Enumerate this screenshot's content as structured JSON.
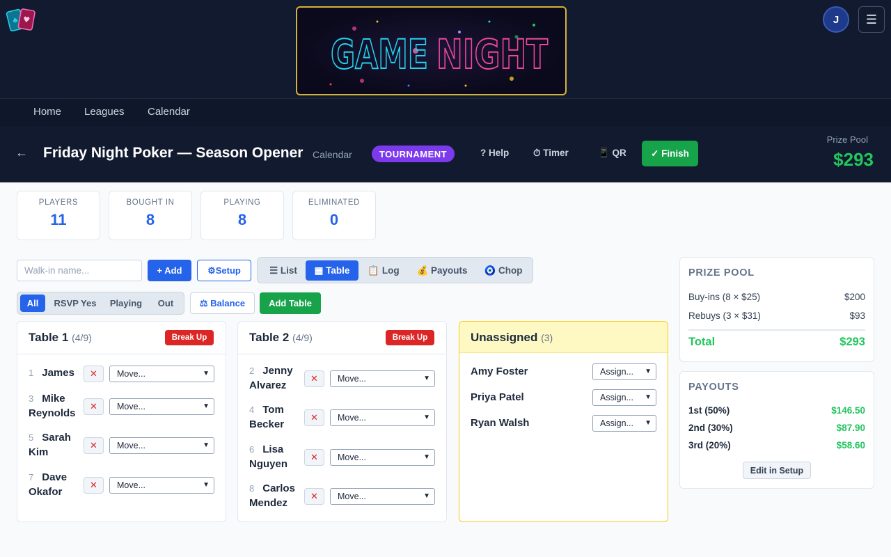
{
  "header": {
    "banner_word1": "GAME",
    "banner_word2": "NIGHT",
    "avatar_initial": "J",
    "menu_icon": "☰"
  },
  "nav": {
    "items": [
      "Home",
      "Leagues",
      "Calendar"
    ]
  },
  "event": {
    "back": "←",
    "title": "Friday Night Poker — Season Opener",
    "subtitle": "Calendar",
    "badge": "TOURNAMENT",
    "help": "? Help",
    "timer": "⏱ Timer",
    "qr": "📱 QR",
    "finish": "✓ Finish",
    "prize_pool_label": "Prize Pool",
    "prize_pool_value": "$293"
  },
  "stats": [
    {
      "label": "PLAYERS",
      "value": "11"
    },
    {
      "label": "BOUGHT IN",
      "value": "8"
    },
    {
      "label": "PLAYING",
      "value": "8"
    },
    {
      "label": "ELIMINATED",
      "value": "0"
    }
  ],
  "controls": {
    "walkin_placeholder": "Walk-in name...",
    "add": "+ Add",
    "setup": "⚙Setup",
    "view_tabs": [
      "☰ List",
      "▦ Table",
      "📋 Log",
      "💰 Payouts",
      "🧿 Chop"
    ],
    "active_view": "▦ Table",
    "filters": [
      "All",
      "RSVP Yes",
      "Playing",
      "Out"
    ],
    "active_filter": "All",
    "balance": "⚖ Balance",
    "add_table": "Add Table"
  },
  "tables": [
    {
      "name": "Table 1",
      "count": "(4/9)",
      "break_up": "Break Up",
      "players": [
        {
          "seat": "1",
          "first": "James",
          "last": "",
          "move": "Move..."
        },
        {
          "seat": "3",
          "first": "Mike",
          "last": "Reynolds",
          "move": "Move..."
        },
        {
          "seat": "5",
          "first": "Sarah",
          "last": "Kim",
          "move": "Move..."
        },
        {
          "seat": "7",
          "first": "Dave",
          "last": "Okafor",
          "move": "Move..."
        }
      ]
    },
    {
      "name": "Table 2",
      "count": "(4/9)",
      "break_up": "Break Up",
      "players": [
        {
          "seat": "2",
          "first": "Jenny",
          "last": "Alvarez",
          "move": "Move..."
        },
        {
          "seat": "4",
          "first": "Tom",
          "last": "Becker",
          "move": "Move..."
        },
        {
          "seat": "6",
          "first": "Lisa",
          "last": "Nguyen",
          "move": "Move..."
        },
        {
          "seat": "8",
          "first": "Carlos",
          "last": "Mendez",
          "move": "Move..."
        }
      ]
    }
  ],
  "remove_icon": "✕",
  "unassigned": {
    "title": "Unassigned",
    "count": "(3)",
    "players": [
      {
        "name": "Amy Foster",
        "assign": "Assign..."
      },
      {
        "name": "Priya Patel",
        "assign": "Assign..."
      },
      {
        "name": "Ryan Walsh",
        "assign": "Assign..."
      }
    ]
  },
  "prize_panel": {
    "title": "PRIZE POOL",
    "rows": [
      {
        "label": "Buy-ins (8 × $25)",
        "value": "$200"
      },
      {
        "label": "Rebuys (3 × $31)",
        "value": "$93"
      }
    ],
    "total_label": "Total",
    "total_value": "$293"
  },
  "payouts_panel": {
    "title": "PAYOUTS",
    "rows": [
      {
        "label": "1st (50%)",
        "value": "$146.50"
      },
      {
        "label": "2nd (30%)",
        "value": "$87.90"
      },
      {
        "label": "3rd (20%)",
        "value": "$58.60"
      }
    ],
    "edit": "Edit in Setup"
  },
  "colors": {
    "header_bg": "#111a2e",
    "primary": "#2563eb",
    "success": "#16a34a",
    "danger": "#dc2626",
    "badge": "#7c3aed",
    "money": "#22c55e",
    "neon_cyan": "#22d3ee",
    "neon_pink": "#ec4899"
  }
}
